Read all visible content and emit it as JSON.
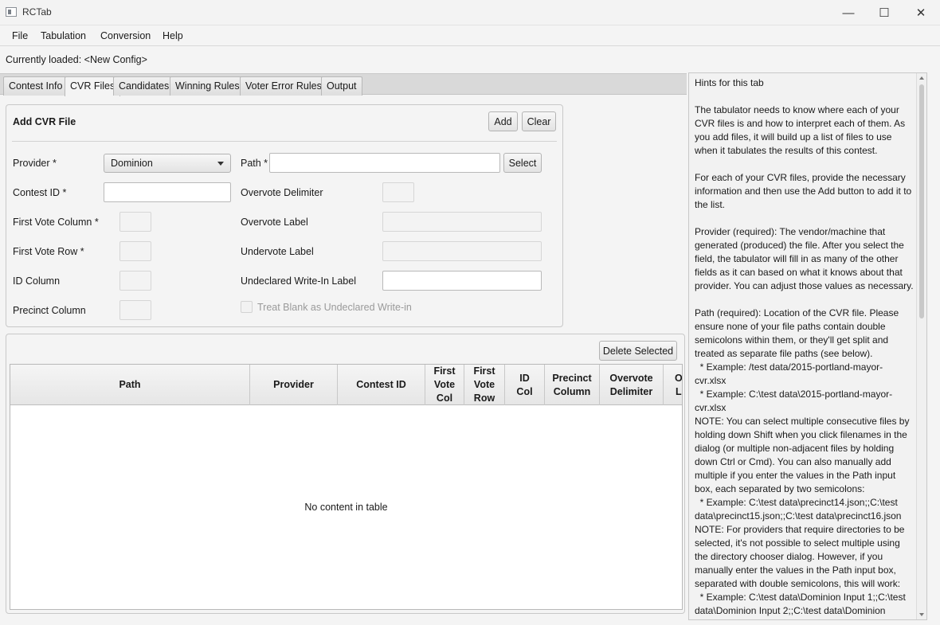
{
  "window": {
    "title": "RCTab",
    "minimize": "—",
    "maximize": "☐",
    "close": "✕"
  },
  "menu": [
    "File",
    "Tabulation",
    "Conversion",
    "Help"
  ],
  "status": {
    "loaded": "Currently loaded: <New Config>"
  },
  "tabs": [
    "Contest Info",
    "CVR Files",
    "Candidates",
    "Winning Rules",
    "Voter Error Rules",
    "Output"
  ],
  "active_tab": "CVR Files",
  "add_cvr": {
    "title": "Add CVR File",
    "add_label": "Add",
    "clear_label": "Clear",
    "provider_label": "Provider *",
    "provider_value": "Dominion",
    "path_label": "Path *",
    "path_value": "",
    "select_label": "Select",
    "contest_id_label": "Contest ID *",
    "contest_id_value": "",
    "overvote_delimiter_label": "Overvote Delimiter",
    "first_vote_column_label": "First Vote Column *",
    "overvote_label_label": "Overvote Label",
    "first_vote_row_label": "First Vote Row *",
    "undervote_label_label": "Undervote Label",
    "id_column_label": "ID Column",
    "undeclared_writein_label": "Undeclared Write-In Label",
    "undeclared_writein_value": "",
    "precinct_column_label": "Precinct Column",
    "treat_blank_label": "Treat Blank as Undeclared Write-in"
  },
  "table": {
    "delete_label": "Delete Selected",
    "columns": [
      "Path",
      "Provider",
      "Contest ID",
      "First\nVote\nCol",
      "First\nVote\nRow",
      "ID\nCol",
      "Precinct\nColumn",
      "Overvote\nDelimiter",
      "O\nL"
    ],
    "empty_message": "No content in table"
  },
  "hints": {
    "title": "Hints for this tab",
    "body": "The tabulator needs to know where each of your CVR files is and how to interpret each of them. As you add files, it will build up a list of files to use when it tabulates the results of this contest.\n\nFor each of your CVR files, provide the necessary information and then use the Add button to add it to the list.\n\nProvider (required): The vendor/machine that generated (produced) the file. After you select the field, the tabulator will fill in as many of the other fields as it can based on what it knows about that provider. You can adjust those values as necessary.\n\nPath (required): Location of the CVR file. Please ensure none of your file paths contain double semicolons within them, or they'll get split and treated as separate file paths (see below).\n  * Example: /test data/2015-portland-mayor-cvr.xlsx\n  * Example: C:\\test data\\2015-portland-mayor-cvr.xlsx\nNOTE: You can select multiple consecutive files by holding down Shift when you click filenames in the dialog (or multiple non-adjacent files by holding down Ctrl or Cmd). You can also manually add multiple if you enter the values in the Path input box, each separated by two semicolons:\n  * Example: C:\\test data\\precinct14.json;;C:\\test data\\precinct15.json;;C:\\test data\\precinct16.json\nNOTE: For providers that require directories to be selected, it's not possible to select multiple using the directory chooser dialog. However, if you manually enter the values in the Path input box, separated with double semicolons, this will work:\n  * Example: C:\\test data\\Dominion Input 1;;C:\\test data\\Dominion Input 2;;C:\\test data\\Dominion"
  }
}
